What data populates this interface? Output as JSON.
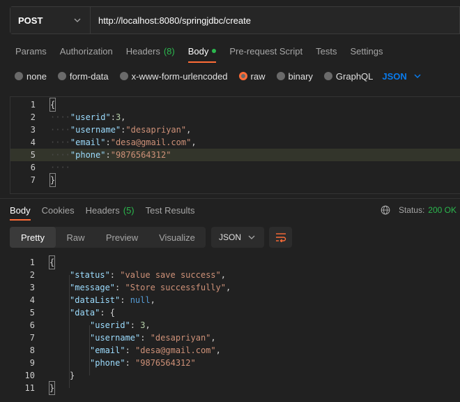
{
  "request": {
    "method": "POST",
    "url": "http://localhost:8080/springjdbc/create"
  },
  "request_tabs": [
    {
      "label": "Params"
    },
    {
      "label": "Authorization"
    },
    {
      "label": "Headers",
      "count": "(8)"
    },
    {
      "label": "Body",
      "active": true
    },
    {
      "label": "Pre-request Script"
    },
    {
      "label": "Tests"
    },
    {
      "label": "Settings"
    }
  ],
  "body_types": {
    "options": [
      "none",
      "form-data",
      "x-www-form-urlencoded",
      "raw",
      "binary",
      "GraphQL"
    ],
    "selected": "raw",
    "format": "JSON"
  },
  "request_body": {
    "lines": [
      {
        "n": "1",
        "dots": "",
        "parts": [
          [
            "p",
            "{"
          ]
        ]
      },
      {
        "n": "2",
        "dots": "····",
        "parts": [
          [
            "k",
            "\"userid\""
          ],
          [
            "p",
            ":"
          ],
          [
            "num",
            "3"
          ],
          [
            "p",
            ","
          ]
        ]
      },
      {
        "n": "3",
        "dots": "····",
        "parts": [
          [
            "k",
            "\"username\""
          ],
          [
            "p",
            ":"
          ],
          [
            "s",
            "\"desapriyan\""
          ],
          [
            "p",
            ","
          ]
        ]
      },
      {
        "n": "4",
        "dots": "····",
        "parts": [
          [
            "k",
            "\"email\""
          ],
          [
            "p",
            ":"
          ],
          [
            "s",
            "\"desa@gmail.com\""
          ],
          [
            "p",
            ","
          ]
        ]
      },
      {
        "n": "5",
        "dots": "····",
        "parts": [
          [
            "k",
            "\"phone\""
          ],
          [
            "p",
            ":"
          ],
          [
            "s",
            "\"9876564312\""
          ]
        ]
      },
      {
        "n": "6",
        "dots": "····",
        "parts": []
      },
      {
        "n": "7",
        "dots": "",
        "parts": [
          [
            "p",
            "}"
          ]
        ]
      }
    ]
  },
  "response_tabs": [
    {
      "label": "Body",
      "active": true
    },
    {
      "label": "Cookies"
    },
    {
      "label": "Headers",
      "count": "(5)"
    },
    {
      "label": "Test Results"
    }
  ],
  "status": {
    "label": "Status:",
    "value": "200 OK"
  },
  "view_tabs": [
    "Pretty",
    "Raw",
    "Preview",
    "Visualize"
  ],
  "response_format": "JSON",
  "response_body": {
    "lines": [
      {
        "n": "1",
        "indent": 0,
        "parts": [
          [
            "p",
            "{"
          ]
        ]
      },
      {
        "n": "2",
        "indent": 1,
        "parts": [
          [
            "k",
            "\"status\""
          ],
          [
            "p",
            ": "
          ],
          [
            "s",
            "\"value save success\""
          ],
          [
            "p",
            ","
          ]
        ]
      },
      {
        "n": "3",
        "indent": 1,
        "parts": [
          [
            "k",
            "\"message\""
          ],
          [
            "p",
            ": "
          ],
          [
            "s",
            "\"Store successfully\""
          ],
          [
            "p",
            ","
          ]
        ]
      },
      {
        "n": "4",
        "indent": 1,
        "parts": [
          [
            "k",
            "\"dataList\""
          ],
          [
            "p",
            ": "
          ],
          [
            "kw",
            "null"
          ],
          [
            "p",
            ","
          ]
        ]
      },
      {
        "n": "5",
        "indent": 1,
        "parts": [
          [
            "k",
            "\"data\""
          ],
          [
            "p",
            ": {"
          ]
        ]
      },
      {
        "n": "6",
        "indent": 2,
        "parts": [
          [
            "k",
            "\"userid\""
          ],
          [
            "p",
            ": "
          ],
          [
            "num",
            "3"
          ],
          [
            "p",
            ","
          ]
        ]
      },
      {
        "n": "7",
        "indent": 2,
        "parts": [
          [
            "k",
            "\"username\""
          ],
          [
            "p",
            ": "
          ],
          [
            "s",
            "\"desapriyan\""
          ],
          [
            "p",
            ","
          ]
        ]
      },
      {
        "n": "8",
        "indent": 2,
        "parts": [
          [
            "k",
            "\"email\""
          ],
          [
            "p",
            ": "
          ],
          [
            "s",
            "\"desa@gmail.com\""
          ],
          [
            "p",
            ","
          ]
        ]
      },
      {
        "n": "9",
        "indent": 2,
        "parts": [
          [
            "k",
            "\"phone\""
          ],
          [
            "p",
            ": "
          ],
          [
            "s",
            "\"9876564312\""
          ]
        ]
      },
      {
        "n": "10",
        "indent": 1,
        "parts": [
          [
            "p",
            "}"
          ]
        ]
      },
      {
        "n": "11",
        "indent": 0,
        "parts": [
          [
            "p",
            "}"
          ]
        ]
      }
    ]
  },
  "colors": {
    "accent": "#ff6c37",
    "success": "#2bb84e",
    "link": "#097bed"
  }
}
